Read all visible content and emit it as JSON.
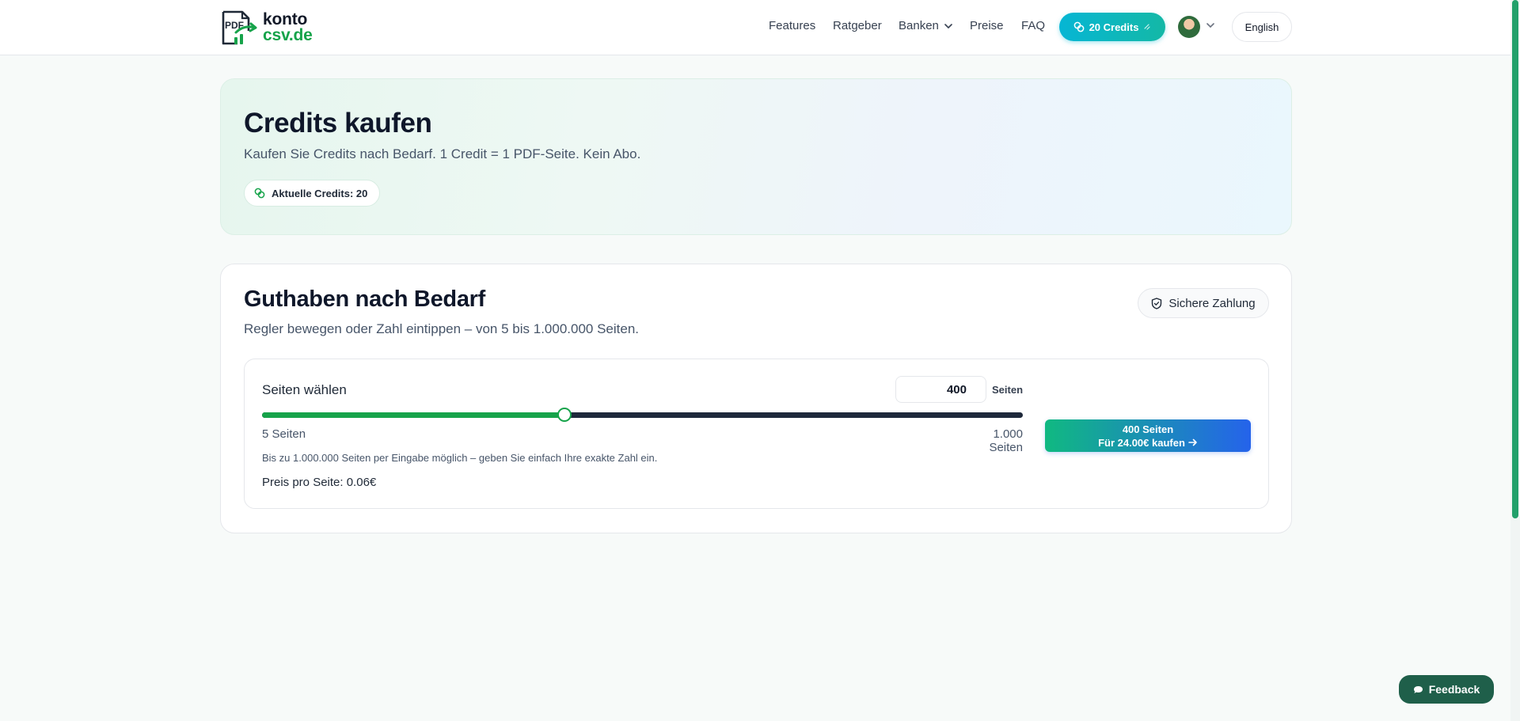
{
  "header": {
    "logo": {
      "pdf_mark": "PDF",
      "line1": "konto",
      "line2": "csv.de"
    },
    "nav": [
      {
        "label": "Features"
      },
      {
        "label": "Ratgeber"
      },
      {
        "label": "Banken"
      },
      {
        "label": "Preise"
      },
      {
        "label": "FAQ"
      }
    ],
    "credits_label": "20 Credits",
    "language": "English"
  },
  "hero": {
    "title": "Credits kaufen",
    "subtitle": "Kaufen Sie Credits nach Bedarf. 1 Credit = 1 PDF-Seite. Kein Abo.",
    "badge": "Aktuelle Credits: 20"
  },
  "purchase": {
    "title": "Guthaben nach Bedarf",
    "description": "Regler bewegen oder Zahl eintippen – von 5 bis 1.000.000 Seiten.",
    "secure_label": "Sichere Zahlung",
    "select_label": "Seiten wählen",
    "pages_value": "400",
    "pages_unit": "Seiten",
    "slider_min_label": "5 Seiten",
    "slider_max_label": "1.000 Seiten",
    "slider_fraction": 0.397,
    "hint": "Bis zu 1.000.000 Seiten per Eingabe möglich – geben Sie einfach Ihre exakte Zahl ein.",
    "price_per_page": "Preis pro Seite: 0.06€",
    "buy_line1": "400 Seiten",
    "buy_line2": "Für 24.00€ kaufen"
  },
  "feedback_label": "Feedback",
  "colors": {
    "accent_green": "#16a34a",
    "accent_cyan": "#06b6d4",
    "button_gradient_start": "#10b981",
    "button_gradient_end": "#2563eb"
  }
}
